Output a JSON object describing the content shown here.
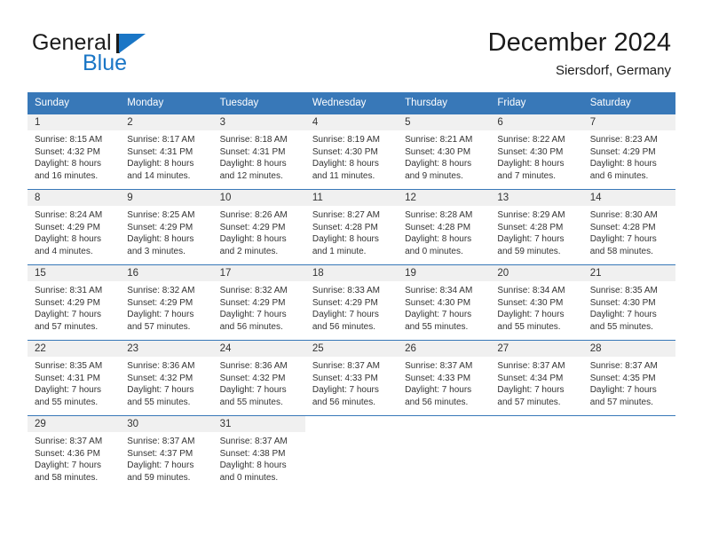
{
  "brand": {
    "name_part1": "General",
    "name_part2": "Blue",
    "mark_color": "#1a76c6"
  },
  "header": {
    "title": "December 2024",
    "location": "Siersdorf, Germany"
  },
  "theme": {
    "header_blue": "#3878b8",
    "daynum_band": "#f0f0f0",
    "text": "#333333"
  },
  "weekdays": [
    "Sunday",
    "Monday",
    "Tuesday",
    "Wednesday",
    "Thursday",
    "Friday",
    "Saturday"
  ],
  "weeks": [
    [
      {
        "day": "1",
        "sunrise": "Sunrise: 8:15 AM",
        "sunset": "Sunset: 4:32 PM",
        "daylight1": "Daylight: 8 hours",
        "daylight2": "and 16 minutes."
      },
      {
        "day": "2",
        "sunrise": "Sunrise: 8:17 AM",
        "sunset": "Sunset: 4:31 PM",
        "daylight1": "Daylight: 8 hours",
        "daylight2": "and 14 minutes."
      },
      {
        "day": "3",
        "sunrise": "Sunrise: 8:18 AM",
        "sunset": "Sunset: 4:31 PM",
        "daylight1": "Daylight: 8 hours",
        "daylight2": "and 12 minutes."
      },
      {
        "day": "4",
        "sunrise": "Sunrise: 8:19 AM",
        "sunset": "Sunset: 4:30 PM",
        "daylight1": "Daylight: 8 hours",
        "daylight2": "and 11 minutes."
      },
      {
        "day": "5",
        "sunrise": "Sunrise: 8:21 AM",
        "sunset": "Sunset: 4:30 PM",
        "daylight1": "Daylight: 8 hours",
        "daylight2": "and 9 minutes."
      },
      {
        "day": "6",
        "sunrise": "Sunrise: 8:22 AM",
        "sunset": "Sunset: 4:30 PM",
        "daylight1": "Daylight: 8 hours",
        "daylight2": "and 7 minutes."
      },
      {
        "day": "7",
        "sunrise": "Sunrise: 8:23 AM",
        "sunset": "Sunset: 4:29 PM",
        "daylight1": "Daylight: 8 hours",
        "daylight2": "and 6 minutes."
      }
    ],
    [
      {
        "day": "8",
        "sunrise": "Sunrise: 8:24 AM",
        "sunset": "Sunset: 4:29 PM",
        "daylight1": "Daylight: 8 hours",
        "daylight2": "and 4 minutes."
      },
      {
        "day": "9",
        "sunrise": "Sunrise: 8:25 AM",
        "sunset": "Sunset: 4:29 PM",
        "daylight1": "Daylight: 8 hours",
        "daylight2": "and 3 minutes."
      },
      {
        "day": "10",
        "sunrise": "Sunrise: 8:26 AM",
        "sunset": "Sunset: 4:29 PM",
        "daylight1": "Daylight: 8 hours",
        "daylight2": "and 2 minutes."
      },
      {
        "day": "11",
        "sunrise": "Sunrise: 8:27 AM",
        "sunset": "Sunset: 4:28 PM",
        "daylight1": "Daylight: 8 hours",
        "daylight2": "and 1 minute."
      },
      {
        "day": "12",
        "sunrise": "Sunrise: 8:28 AM",
        "sunset": "Sunset: 4:28 PM",
        "daylight1": "Daylight: 8 hours",
        "daylight2": "and 0 minutes."
      },
      {
        "day": "13",
        "sunrise": "Sunrise: 8:29 AM",
        "sunset": "Sunset: 4:28 PM",
        "daylight1": "Daylight: 7 hours",
        "daylight2": "and 59 minutes."
      },
      {
        "day": "14",
        "sunrise": "Sunrise: 8:30 AM",
        "sunset": "Sunset: 4:28 PM",
        "daylight1": "Daylight: 7 hours",
        "daylight2": "and 58 minutes."
      }
    ],
    [
      {
        "day": "15",
        "sunrise": "Sunrise: 8:31 AM",
        "sunset": "Sunset: 4:29 PM",
        "daylight1": "Daylight: 7 hours",
        "daylight2": "and 57 minutes."
      },
      {
        "day": "16",
        "sunrise": "Sunrise: 8:32 AM",
        "sunset": "Sunset: 4:29 PM",
        "daylight1": "Daylight: 7 hours",
        "daylight2": "and 57 minutes."
      },
      {
        "day": "17",
        "sunrise": "Sunrise: 8:32 AM",
        "sunset": "Sunset: 4:29 PM",
        "daylight1": "Daylight: 7 hours",
        "daylight2": "and 56 minutes."
      },
      {
        "day": "18",
        "sunrise": "Sunrise: 8:33 AM",
        "sunset": "Sunset: 4:29 PM",
        "daylight1": "Daylight: 7 hours",
        "daylight2": "and 56 minutes."
      },
      {
        "day": "19",
        "sunrise": "Sunrise: 8:34 AM",
        "sunset": "Sunset: 4:30 PM",
        "daylight1": "Daylight: 7 hours",
        "daylight2": "and 55 minutes."
      },
      {
        "day": "20",
        "sunrise": "Sunrise: 8:34 AM",
        "sunset": "Sunset: 4:30 PM",
        "daylight1": "Daylight: 7 hours",
        "daylight2": "and 55 minutes."
      },
      {
        "day": "21",
        "sunrise": "Sunrise: 8:35 AM",
        "sunset": "Sunset: 4:30 PM",
        "daylight1": "Daylight: 7 hours",
        "daylight2": "and 55 minutes."
      }
    ],
    [
      {
        "day": "22",
        "sunrise": "Sunrise: 8:35 AM",
        "sunset": "Sunset: 4:31 PM",
        "daylight1": "Daylight: 7 hours",
        "daylight2": "and 55 minutes."
      },
      {
        "day": "23",
        "sunrise": "Sunrise: 8:36 AM",
        "sunset": "Sunset: 4:32 PM",
        "daylight1": "Daylight: 7 hours",
        "daylight2": "and 55 minutes."
      },
      {
        "day": "24",
        "sunrise": "Sunrise: 8:36 AM",
        "sunset": "Sunset: 4:32 PM",
        "daylight1": "Daylight: 7 hours",
        "daylight2": "and 55 minutes."
      },
      {
        "day": "25",
        "sunrise": "Sunrise: 8:37 AM",
        "sunset": "Sunset: 4:33 PM",
        "daylight1": "Daylight: 7 hours",
        "daylight2": "and 56 minutes."
      },
      {
        "day": "26",
        "sunrise": "Sunrise: 8:37 AM",
        "sunset": "Sunset: 4:33 PM",
        "daylight1": "Daylight: 7 hours",
        "daylight2": "and 56 minutes."
      },
      {
        "day": "27",
        "sunrise": "Sunrise: 8:37 AM",
        "sunset": "Sunset: 4:34 PM",
        "daylight1": "Daylight: 7 hours",
        "daylight2": "and 57 minutes."
      },
      {
        "day": "28",
        "sunrise": "Sunrise: 8:37 AM",
        "sunset": "Sunset: 4:35 PM",
        "daylight1": "Daylight: 7 hours",
        "daylight2": "and 57 minutes."
      }
    ],
    [
      {
        "day": "29",
        "sunrise": "Sunrise: 8:37 AM",
        "sunset": "Sunset: 4:36 PM",
        "daylight1": "Daylight: 7 hours",
        "daylight2": "and 58 minutes."
      },
      {
        "day": "30",
        "sunrise": "Sunrise: 8:37 AM",
        "sunset": "Sunset: 4:37 PM",
        "daylight1": "Daylight: 7 hours",
        "daylight2": "and 59 minutes."
      },
      {
        "day": "31",
        "sunrise": "Sunrise: 8:37 AM",
        "sunset": "Sunset: 4:38 PM",
        "daylight1": "Daylight: 8 hours",
        "daylight2": "and 0 minutes."
      },
      {
        "day": "",
        "sunrise": "",
        "sunset": "",
        "daylight1": "",
        "daylight2": ""
      },
      {
        "day": "",
        "sunrise": "",
        "sunset": "",
        "daylight1": "",
        "daylight2": ""
      },
      {
        "day": "",
        "sunrise": "",
        "sunset": "",
        "daylight1": "",
        "daylight2": ""
      },
      {
        "day": "",
        "sunrise": "",
        "sunset": "",
        "daylight1": "",
        "daylight2": ""
      }
    ]
  ]
}
